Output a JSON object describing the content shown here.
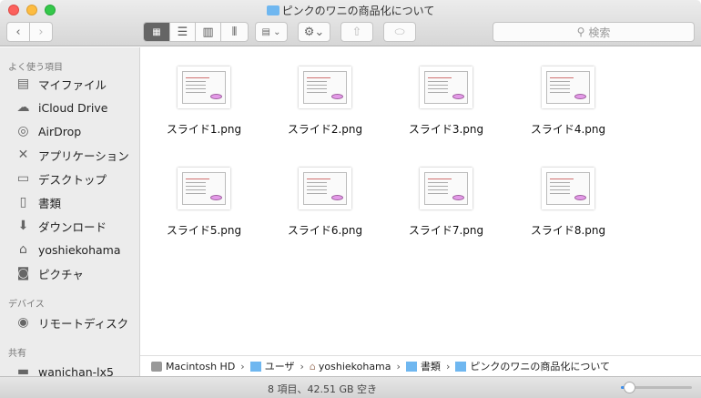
{
  "window": {
    "title": "ピンクのワニの商品化について"
  },
  "toolbar": {
    "search_placeholder": "検索",
    "back": "‹",
    "forward": "›"
  },
  "sidebar": {
    "sections": [
      {
        "heading": "よく使う項目",
        "items": [
          {
            "label": "マイファイル",
            "icon": "all-files-icon"
          },
          {
            "label": "iCloud Drive",
            "icon": "cloud-icon"
          },
          {
            "label": "AirDrop",
            "icon": "airdrop-icon"
          },
          {
            "label": "アプリケーション",
            "icon": "applications-icon"
          },
          {
            "label": "デスクトップ",
            "icon": "desktop-icon"
          },
          {
            "label": "書類",
            "icon": "documents-icon"
          },
          {
            "label": "ダウンロード",
            "icon": "download-icon"
          },
          {
            "label": "yoshiekohama",
            "icon": "home-icon"
          },
          {
            "label": "ピクチャ",
            "icon": "camera-icon"
          }
        ]
      },
      {
        "heading": "デバイス",
        "items": [
          {
            "label": "リモートディスク",
            "icon": "disc-icon"
          }
        ]
      },
      {
        "heading": "共有",
        "items": [
          {
            "label": "wanichan-lx5",
            "icon": "display-icon"
          }
        ]
      }
    ]
  },
  "files": [
    {
      "name": "スライド1.png"
    },
    {
      "name": "スライド2.png"
    },
    {
      "name": "スライド3.png"
    },
    {
      "name": "スライド4.png"
    },
    {
      "name": "スライド5.png"
    },
    {
      "name": "スライド6.png"
    },
    {
      "name": "スライド7.png"
    },
    {
      "name": "スライド8.png"
    }
  ],
  "path": [
    "Macintosh HD",
    "ユーザ",
    "yoshiekohama",
    "書類",
    "ピンクのワニの商品化について"
  ],
  "status": {
    "text": "8 項目、42.51 GB 空き",
    "icon_size": 0.12
  },
  "colors": {
    "accent": "#3b8ff0",
    "folder": "#6fb7f0",
    "croc": "#e49ae8"
  }
}
